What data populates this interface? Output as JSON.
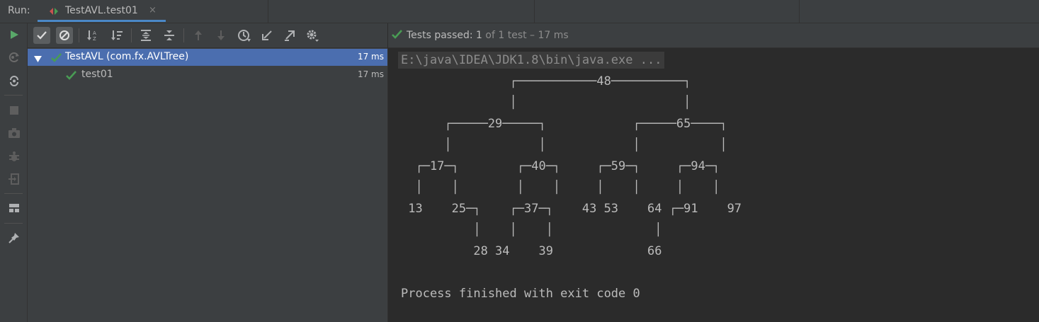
{
  "run_label": "Run:",
  "tab": {
    "title": "TestAVL.test01",
    "close": "×",
    "icon": "run-config-icon"
  },
  "left_toolbar": {
    "icons": [
      "rerun-icon",
      "rerun-failed-icon",
      "toggle-autotest-icon",
      "stop-icon",
      "camera-icon",
      "debug-icon",
      "exit-icon",
      "layout-icon",
      "pin-icon"
    ]
  },
  "test_toolbar": {
    "icons": [
      "show-passed-icon",
      "show-ignored-icon",
      "sort-alpha-icon",
      "sort-duration-icon",
      "expand-all-icon",
      "collapse-all-icon",
      "prev-failed-icon",
      "next-failed-icon",
      "history-icon",
      "import-icon",
      "export-icon",
      "settings-icon"
    ]
  },
  "status": {
    "passed_label": "Tests passed:",
    "count": "1",
    "detail": "of 1 test – 17 ms"
  },
  "tree": {
    "root": {
      "label": "TestAVL (com.fx.AVLTree)",
      "time": "17 ms"
    },
    "child": {
      "label": "test01",
      "time": "17 ms"
    }
  },
  "console": {
    "command": "E:\\java\\IDEA\\JDK1.8\\bin\\java.exe ...",
    "tree_lines": [
      "               ┌───────────48──────────┐",
      "               │                       │",
      "      ┌─────29─────┐            ┌─────65────┐",
      "      │            │            │           │",
      "  ┌─17─┐        ┌─40─┐     ┌─59─┐     ┌─94─┐",
      "  │    │        │    │     │    │     │    │",
      " 13    25─┐    ┌─37─┐    43 53    64 ┌─91    97",
      "          │    │    │              │",
      "          28 34    39             66"
    ],
    "finish": "Process finished with exit code 0"
  },
  "colors": {
    "accent": "#4a88c7",
    "pass_green": "#499c54",
    "selection": "#4b6eaf",
    "run_green": "#59a869"
  }
}
